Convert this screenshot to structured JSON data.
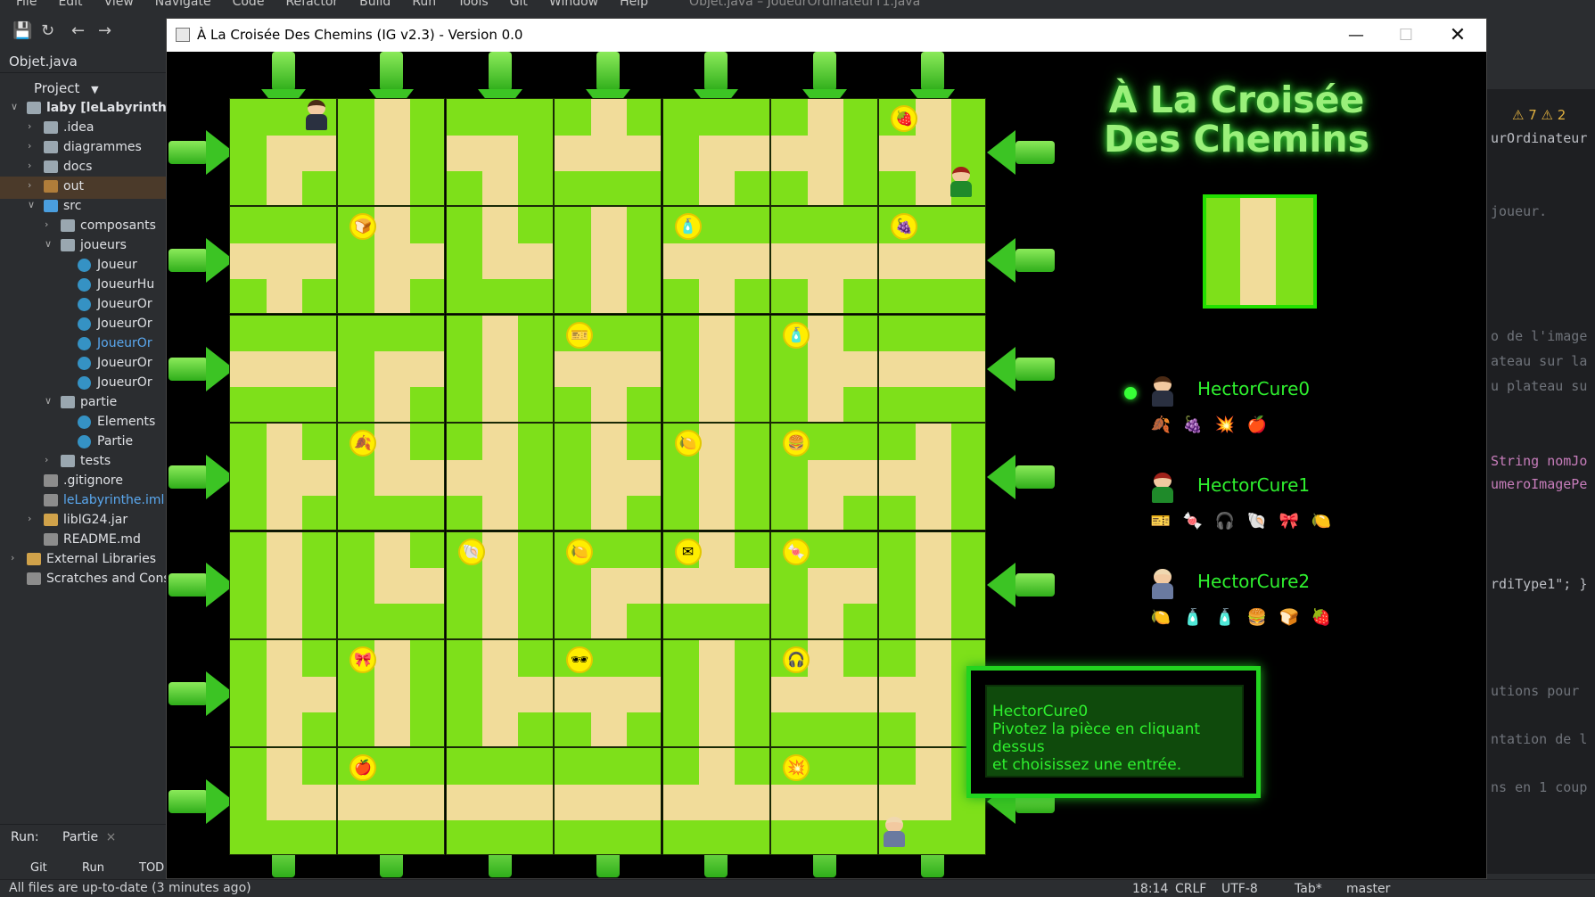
{
  "ide": {
    "menu": [
      "File",
      "Edit",
      "View",
      "Navigate",
      "Code",
      "Refactor",
      "Build",
      "Run",
      "Tools",
      "Git",
      "Window",
      "Help"
    ],
    "window_title": "Objet.java – JoueurOrdinateurT1.java",
    "file_tab": "Objet.java",
    "project_label": "Project",
    "tree": [
      {
        "label": "laby [leLabyrinthe]",
        "kind": "folder"
      },
      {
        "label": ".idea",
        "kind": "folder"
      },
      {
        "label": "diagrammes",
        "kind": "folder"
      },
      {
        "label": "docs",
        "kind": "folder"
      },
      {
        "label": "out",
        "kind": "folder-out"
      },
      {
        "label": "src",
        "kind": "folder-src"
      },
      {
        "label": "composants",
        "kind": "folder"
      },
      {
        "label": "joueurs",
        "kind": "folder"
      },
      {
        "label": "Joueur",
        "kind": "class"
      },
      {
        "label": "JoueurHu",
        "kind": "class"
      },
      {
        "label": "JoueurOr",
        "kind": "class"
      },
      {
        "label": "JoueurOr",
        "kind": "class"
      },
      {
        "label": "JoueurOr",
        "kind": "class"
      },
      {
        "label": "JoueurOr",
        "kind": "class"
      },
      {
        "label": "JoueurOr",
        "kind": "class"
      },
      {
        "label": "partie",
        "kind": "folder"
      },
      {
        "label": "Elements",
        "kind": "class"
      },
      {
        "label": "Partie",
        "kind": "class"
      },
      {
        "label": "tests",
        "kind": "folder"
      },
      {
        "label": ".gitignore",
        "kind": "file"
      },
      {
        "label": "leLabyrinthe.iml",
        "kind": "file"
      },
      {
        "label": "libIG24.jar",
        "kind": "lib"
      },
      {
        "label": "README.md",
        "kind": "file"
      },
      {
        "label": "External Libraries",
        "kind": "lib"
      },
      {
        "label": "Scratches and Cons",
        "kind": "file"
      }
    ],
    "run_label": "Run:",
    "run_config": "Partie",
    "bottom_tabs": [
      "Git",
      "Run",
      "TOD"
    ],
    "status_left": "All files are up-to-date (3 minutes ago)",
    "status_right": [
      "18:14",
      "CRLF",
      "UTF-8",
      "Tab*",
      "master"
    ],
    "warnings": "⚠ 7  ⚠ 2",
    "code_lines": [
      "urOrdinateur",
      "joueur.",
      "o de l'image",
      "ateau sur la",
      "u plateau su",
      "String nomJo",
      "umeroImagePe",
      "rdiType1\"; }",
      "utions pour",
      "ntation de l",
      "ns en 1 coup"
    ]
  },
  "game": {
    "window_title": "À La Croisée Des Chemins  (IG v2.3) - Version 0.0",
    "controls": {
      "minimize": "—",
      "maximize": "☐",
      "close": "✕"
    },
    "title_line1": "À La Croisée",
    "title_line2": "Des Chemins",
    "players": [
      {
        "name": "HectorCure0",
        "active": true,
        "hair": "#4a2a14",
        "body": "#2a3040",
        "items": [
          "🍂",
          "🍇",
          "💥",
          "🍎",
          "✉",
          "🕶"
        ]
      },
      {
        "name": "HectorCure1",
        "active": false,
        "hair": "#a0221a",
        "body": "#1f8a2a",
        "items": [
          "🎫",
          "🍬",
          "🎧",
          "🐚",
          "🎀",
          "🍋"
        ]
      },
      {
        "name": "HectorCure2",
        "active": false,
        "hair": "#f0d8b0",
        "body": "#6a7aa0",
        "items": [
          "🍋",
          "🧴",
          "🧴",
          "🍔",
          "🍞",
          "🍓"
        ]
      }
    ],
    "message_line1": "HectorCure0",
    "message_line2": "Pivotez la pièce en cliquant dessus",
    "message_line3": "et choisissez une entrée."
  }
}
